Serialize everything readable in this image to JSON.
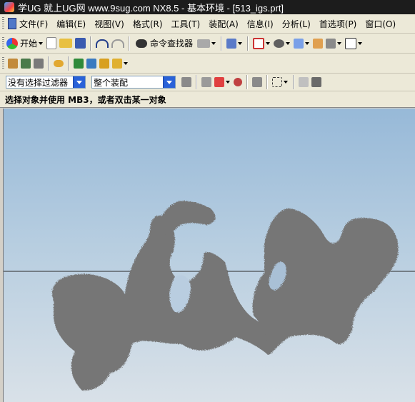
{
  "window": {
    "title": "学UG 就上UG网  www.9sug.com NX8.5 - 基本环境 - [513_igs.prt]"
  },
  "menu": {
    "items": [
      {
        "label": "文件(F)"
      },
      {
        "label": "编辑(E)"
      },
      {
        "label": "视图(V)"
      },
      {
        "label": "格式(R)"
      },
      {
        "label": "工具(T)"
      },
      {
        "label": "装配(A)"
      },
      {
        "label": "信息(I)"
      },
      {
        "label": "分析(L)"
      },
      {
        "label": "首选项(P)"
      },
      {
        "label": "窗口(O)"
      }
    ]
  },
  "toolbar": {
    "start_label": "开始",
    "command_finder_label": "命令查找器"
  },
  "filterbar": {
    "type_filter_value": "没有选择过滤器",
    "scope_value": "整个装配"
  },
  "status": {
    "prompt": "选择对象并使用 MB3，或者双击某一对象"
  },
  "colors": {
    "titlebar_bg": "#1c1c1c",
    "ui_bg": "#ece9d8",
    "model_gray": "#767676"
  }
}
